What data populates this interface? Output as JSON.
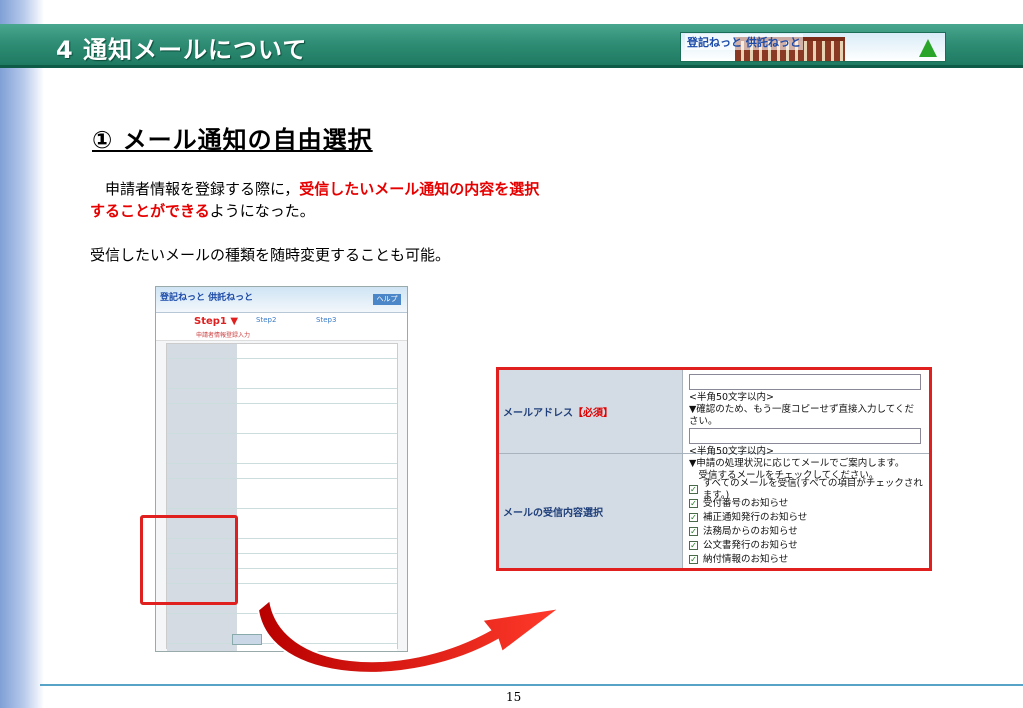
{
  "header": {
    "title": "4 通知メールについて",
    "logo_text": "登記ねっと 供託ねっと"
  },
  "section": {
    "title": "① メール通知の自由選択"
  },
  "body": {
    "p1_a": "　申請者情報を登録する際に，",
    "p1_b": "受信したいメール通知の内容を選択することができる",
    "p1_c": "ようになった。",
    "p2": "受信したいメールの種類を随時変更することも可能。"
  },
  "thumbnail": {
    "logo": "登記ねっと 供託ねっと",
    "help": "ヘルプ",
    "step1": "Step1",
    "step1_sub": "申請者情報登録入力",
    "step2": "Step2",
    "step3": "Step3"
  },
  "zoom_form": {
    "email_label": "メールアドレス",
    "email_required": "【必須】",
    "email_hint1": "<半角50文字以内>",
    "email_hint2": "▼確認のため、もう一度コピーせず直接入力してください。",
    "email_hint3": "<半角50文字以内>",
    "select_label": "メールの受信内容選択",
    "select_note": "▼申請の処理状況に応じてメールでご案内します。\n　受信するメールをチェックしてください。",
    "options": [
      "すべてのメールを受信(すべての項目がチェックされます。)",
      "受付番号のお知らせ",
      "補正通知発行のお知らせ",
      "法務局からのお知らせ",
      "公文書発行のお知らせ",
      "納付情報のお知らせ"
    ]
  },
  "footer": {
    "page_number": "15"
  },
  "colors": {
    "header_green": "#2f8e75",
    "highlight_red": "#e60000",
    "label_bg": "#d3dbe4"
  }
}
